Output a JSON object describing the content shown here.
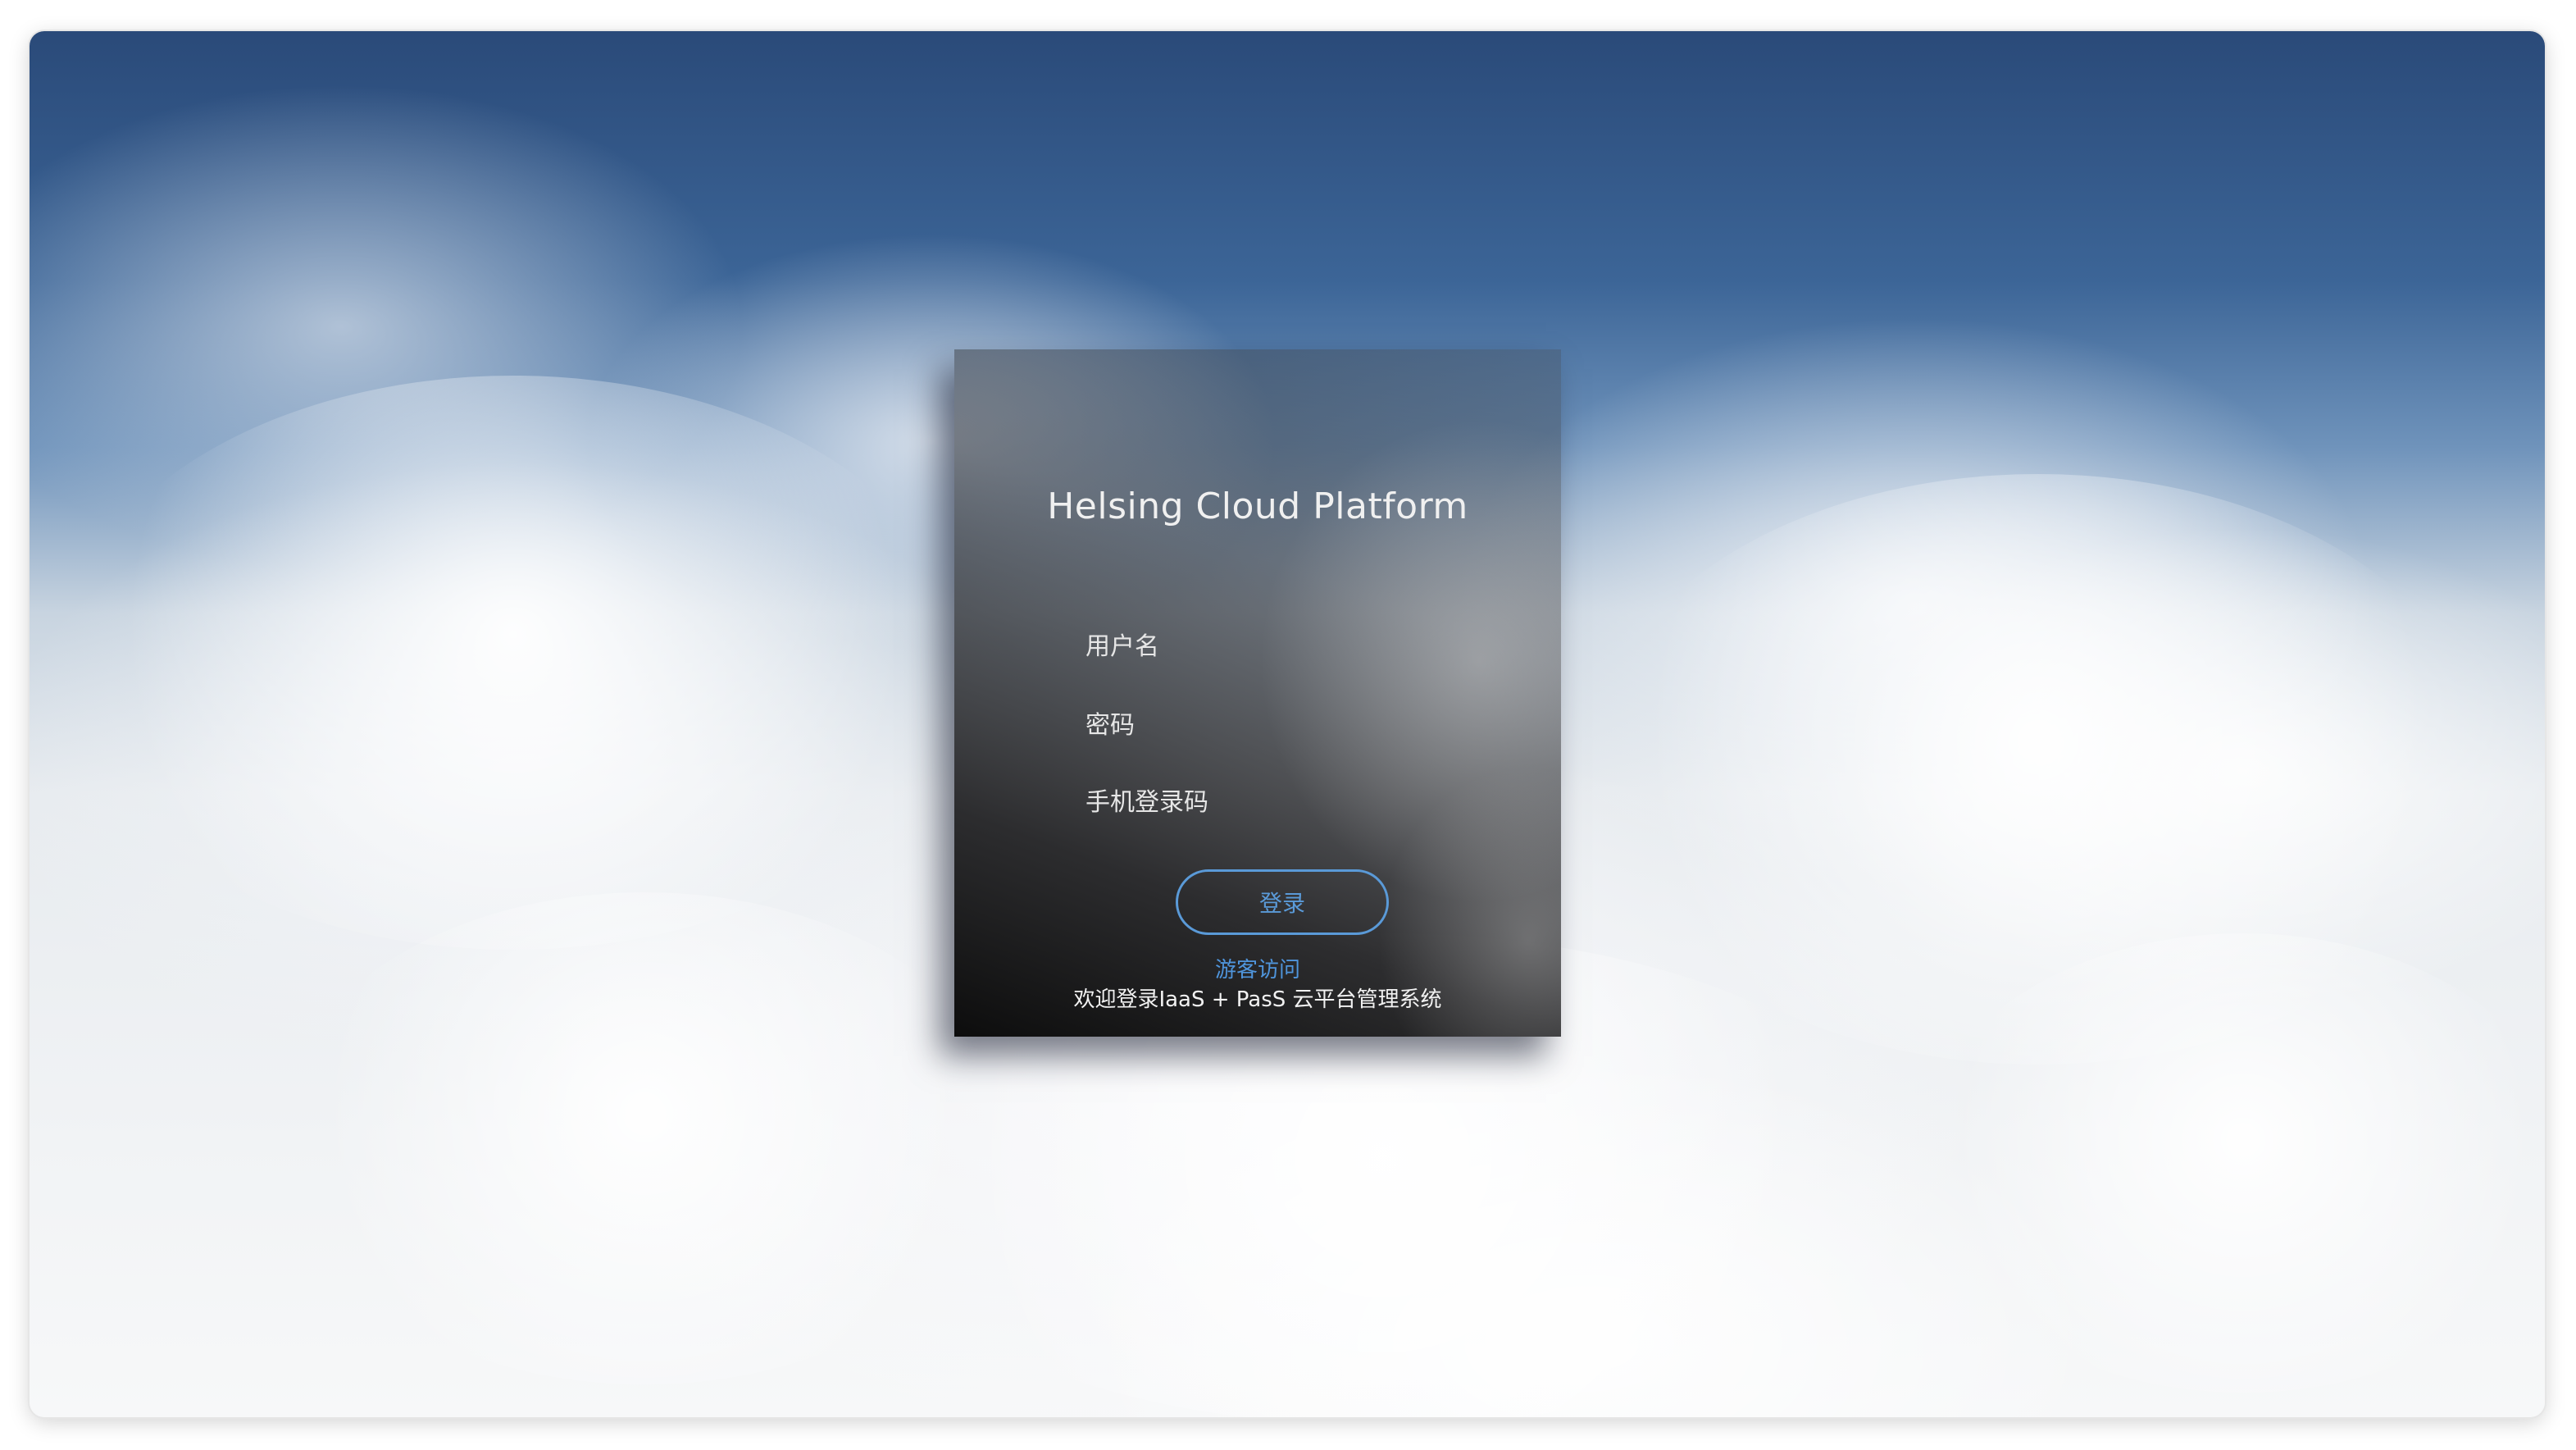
{
  "login": {
    "title": "Helsing Cloud Platform",
    "username_placeholder": "用户名",
    "password_placeholder": "密码",
    "sms_code_placeholder": "手机登录码",
    "login_button": "登录",
    "guest_link": "游客访问",
    "welcome_text": "欢迎登录IaaS + PasS 云平台管理系统"
  },
  "colors": {
    "accent": "#5a9ad8",
    "sky_top": "#2a4a79",
    "card_dark": "#0b0b0b"
  }
}
